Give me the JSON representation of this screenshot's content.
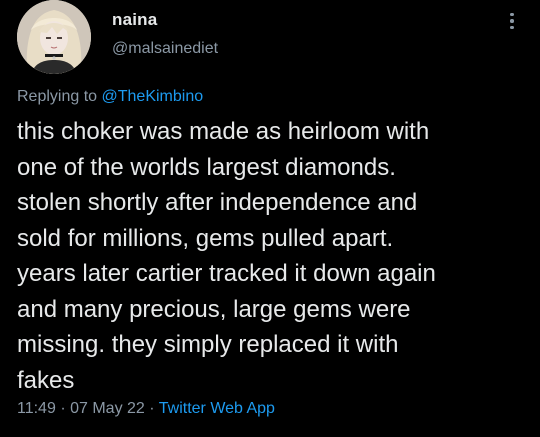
{
  "user": {
    "display_name": "naina",
    "handle": "@malsainediet"
  },
  "reply": {
    "prefix": "Replying to",
    "mention": "@TheKimbino"
  },
  "tweet": {
    "lines": [
      "this choker was made as heirloom with",
      "one of the worlds largest diamonds.",
      "stolen shortly after independence and",
      "sold for millions, gems pulled apart.",
      "years later cartier tracked it down again",
      "and many precious, large gems were",
      "missing. they simply replaced it with",
      "fakes"
    ]
  },
  "meta": {
    "time": "11:49",
    "separator1": "·",
    "date": "07 May 22",
    "separator2": "·",
    "source": "Twitter Web App"
  },
  "colors": {
    "background": "#000000",
    "text": "#e7e9ea",
    "secondary": "#8b98a5",
    "accent": "#1d9bf0"
  },
  "icons": {
    "more": "more-vertical-icon",
    "avatar": "avatar"
  }
}
